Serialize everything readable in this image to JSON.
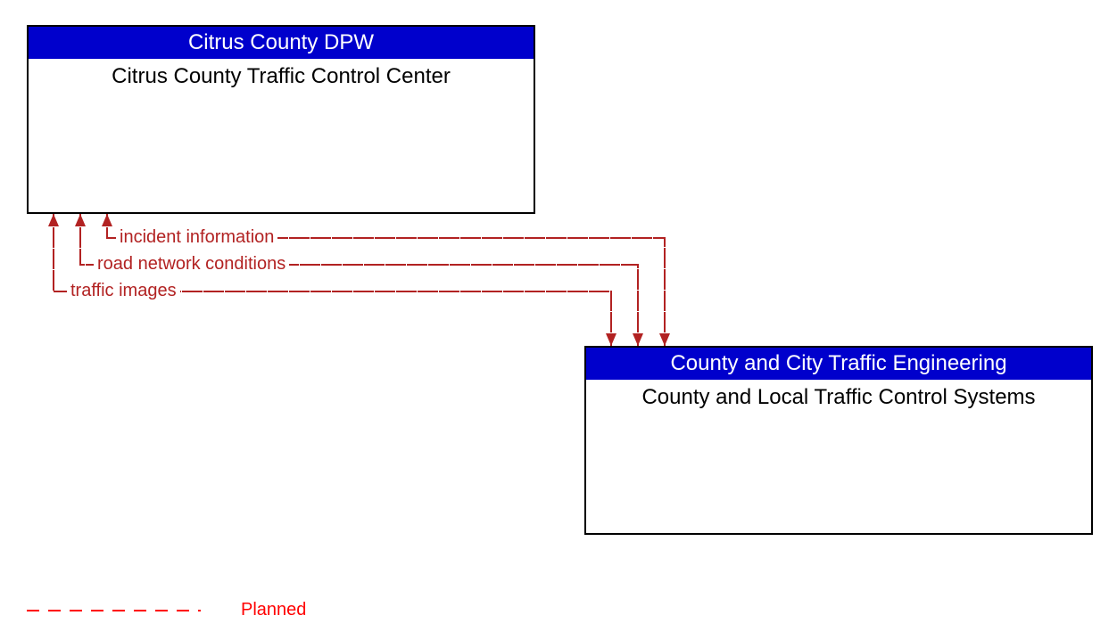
{
  "nodes": {
    "top": {
      "header": "Citrus County DPW",
      "body": "Citrus County Traffic Control Center"
    },
    "bottom": {
      "header": "County and City Traffic Engineering",
      "body": "County and Local Traffic Control Systems"
    }
  },
  "flows": {
    "f1": "incident information",
    "f2": "road network conditions",
    "f3": "traffic images"
  },
  "legend": {
    "planned": "Planned"
  },
  "colors": {
    "header_bg": "#0000cc",
    "flow_line": "#b22222",
    "legend_text": "#ff0000"
  }
}
